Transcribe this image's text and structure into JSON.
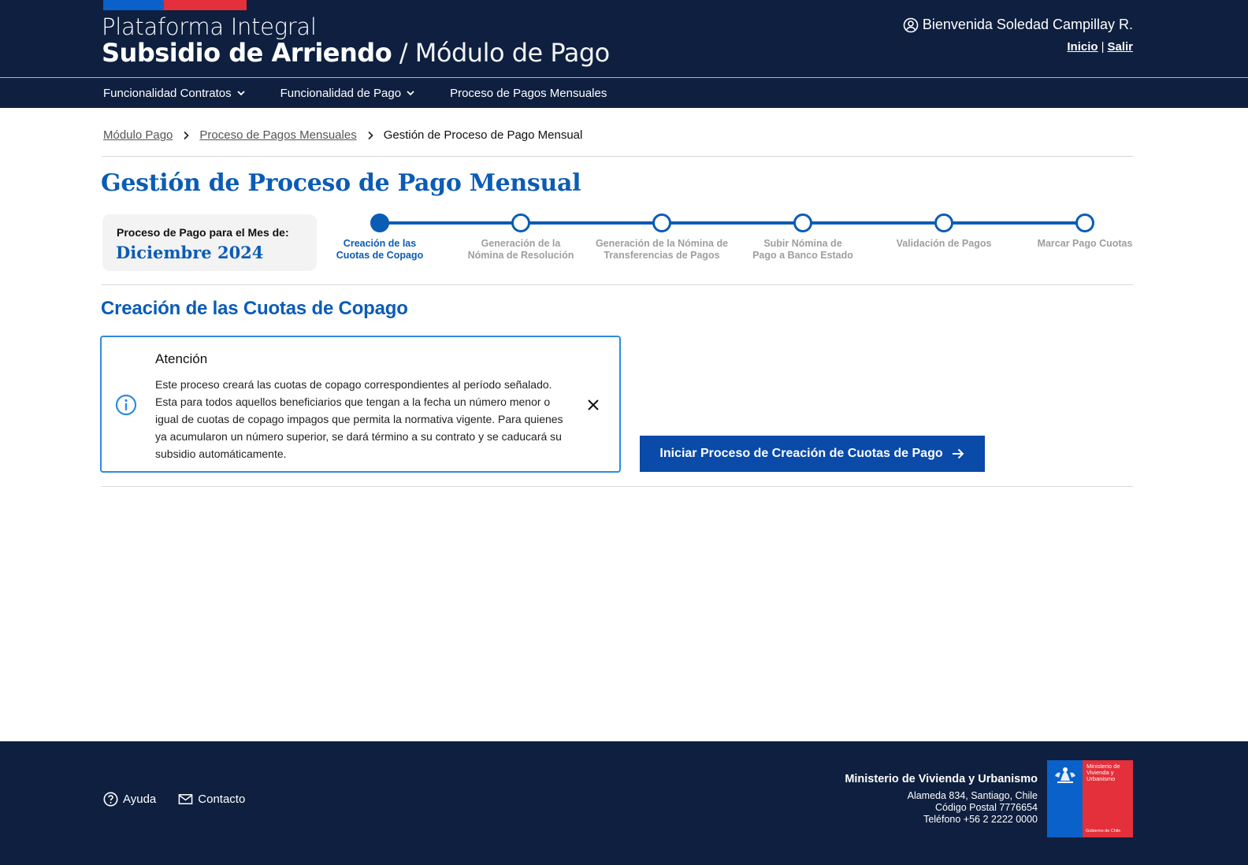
{
  "header": {
    "brand_line1": "Plataforma Integral",
    "brand_bold": "Subsidio de Arriendo",
    "brand_rest": " / Módulo de Pago",
    "welcome": "Bienvenida Soledad Campillay R.",
    "link_home": "Inicio",
    "link_separator": "|",
    "link_logout": "Salir",
    "flag_colors": [
      "#0a61c9",
      "#e3303b"
    ],
    "background": "#0e1f3f"
  },
  "nav": {
    "items": [
      {
        "label": "Funcionalidad Contratos",
        "icon": "chevron-down-icon"
      },
      {
        "label": "Funcionalidad de Pago",
        "icon": "chevron-down-icon"
      },
      {
        "label": "Proceso de Pagos Mensuales",
        "icon": ""
      }
    ]
  },
  "breadcrumb": {
    "items": [
      "Módulo Pago",
      "Proceso de Pagos Mensuales"
    ],
    "current": "Gestión de Proceso de Pago Mensual"
  },
  "page": {
    "title": "Gestión de Proceso de Pago Mensual",
    "accent_color": "#0b5cb5"
  },
  "month_card": {
    "label": "Proceso de Pago para el Mes de:",
    "value": "Diciembre 2024"
  },
  "stepper": {
    "active_index": 0,
    "steps": [
      {
        "line1": "Creación de las",
        "line2": "Cuotas de Copago"
      },
      {
        "line1": "Generación de la",
        "line2": "Nómina de Resolución"
      },
      {
        "line1": "Generación de la Nómina de",
        "line2": "Transferencias de Pagos"
      },
      {
        "line1": "Subir Nómina de",
        "line2": "Pago a Banco Estado"
      },
      {
        "line1": "Validación de Pagos",
        "line2": ""
      },
      {
        "line1": "Marcar Pago Cuotas",
        "line2": ""
      }
    ]
  },
  "section": {
    "title": "Creación de las Cuotas de Copago"
  },
  "alert": {
    "title": "Atención",
    "body": "Este proceso creará las cuotas de copago correspondientes al período señalado. Esta para todos aquellos beneficiarios que tengan a la fecha un número menor o igual de cuotas de copago impagos que permita la normativa vigente. Para quienes ya acumularon un número superior, se dará término a su contrato y se caducará su subsidio automáticamente.",
    "icon": "info-icon",
    "close_icon": "close-icon",
    "border_color": "#2f8ae0"
  },
  "action": {
    "start_label": "Iniciar Proceso de Creación de Cuotas de Pago",
    "icon": "arrow-right-icon",
    "color": "#0a4aa8"
  },
  "footer": {
    "help_label": "Ayuda",
    "contact_label": "Contacto",
    "ministry_name": "Ministerio de Vivienda y Urbanismo",
    "address": "Alameda 834, Santiago, Chile",
    "postal": "Código Postal 7776654",
    "phone": "Teléfono +56 2 2222 0000",
    "logo_text_lines": [
      "Ministerio de",
      "Vivienda y",
      "Urbanismo"
    ],
    "logo_gov": "Gobierno de Chile"
  }
}
